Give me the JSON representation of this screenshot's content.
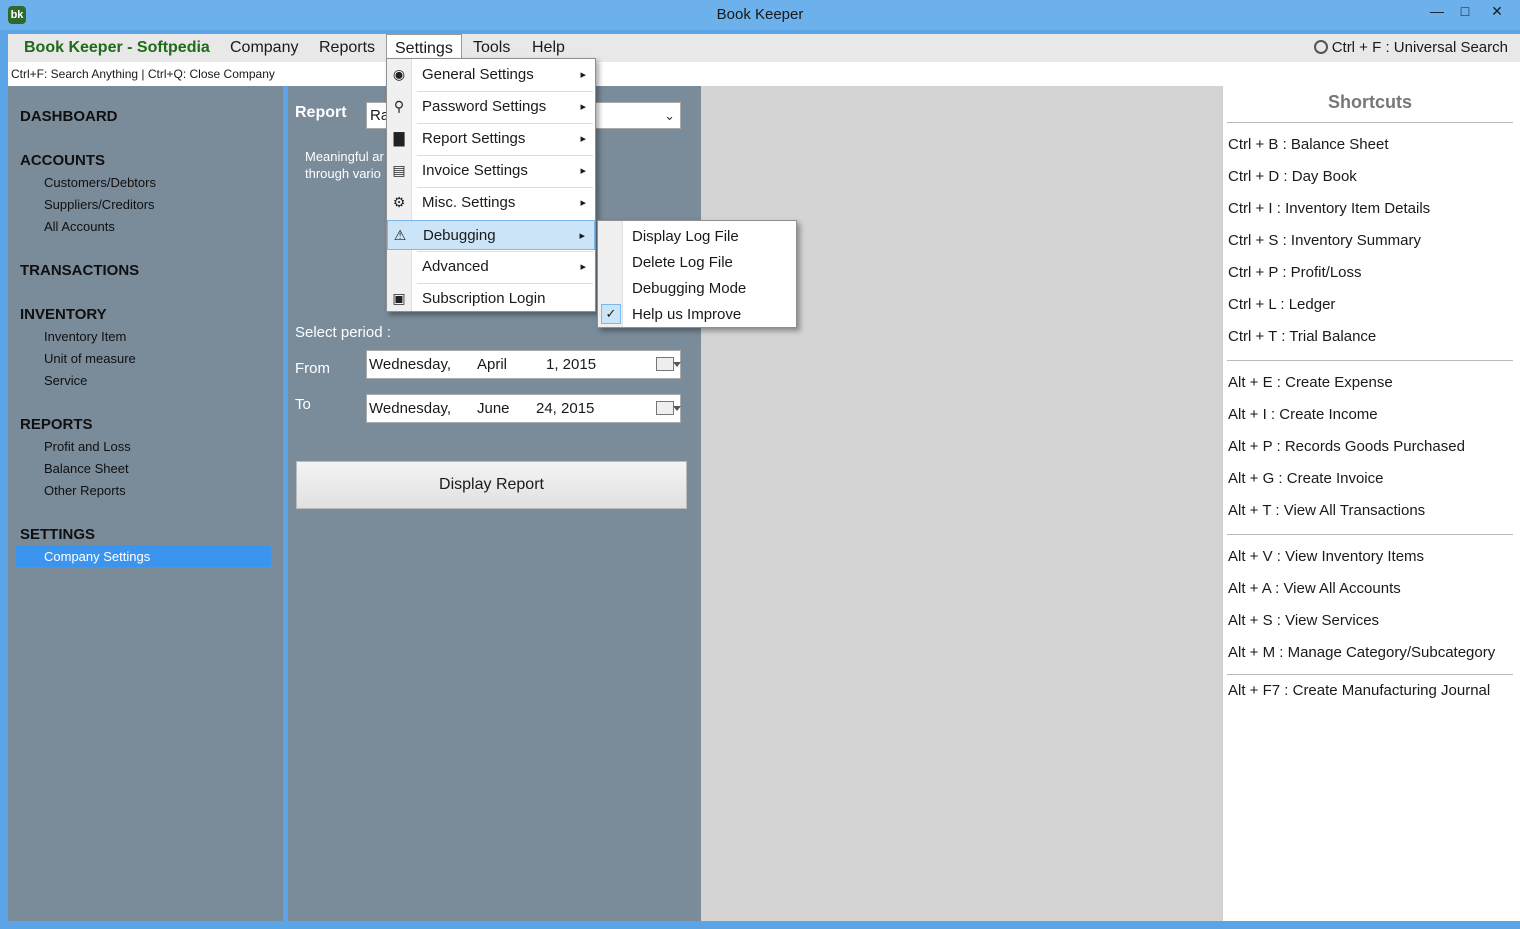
{
  "window": {
    "title": "Book Keeper",
    "app_icon": "bk"
  },
  "menubar": {
    "brand": "Book Keeper - Softpedia",
    "items": [
      "Company",
      "Reports",
      "Settings",
      "Tools",
      "Help"
    ],
    "universal_search": "Ctrl + F  : Universal Search"
  },
  "hint": "Ctrl+F: Search Anything | Ctrl+Q: Close Company",
  "sidebar": {
    "sections": [
      {
        "title": "DASHBOARD",
        "items": []
      },
      {
        "title": "ACCOUNTS",
        "items": [
          "Customers/Debtors",
          "Suppliers/Creditors",
          "All Accounts"
        ]
      },
      {
        "title": "TRANSACTIONS",
        "items": []
      },
      {
        "title": "INVENTORY",
        "items": [
          "Inventory Item",
          "Unit of measure",
          "Service"
        ]
      },
      {
        "title": "REPORTS",
        "items": [
          "Profit and Loss",
          "Balance Sheet",
          "Other Reports"
        ]
      },
      {
        "title": "SETTINGS",
        "items": [
          "Company Settings"
        ]
      }
    ],
    "selected": "Company Settings"
  },
  "report_panel": {
    "report_label": "Report",
    "report_value": "Ra",
    "description_line1": "Meaningful ar",
    "description_line2": "through vario",
    "select_period_label": "Select period :",
    "from_label": "From",
    "to_label": "To",
    "from_date": {
      "weekday": "Wednesday,",
      "month": "April",
      "day_year": "1, 2015"
    },
    "to_date": {
      "weekday": "Wednesday,",
      "month": "June",
      "day_year": "24, 2015"
    },
    "display_button": "Display Report"
  },
  "settings_menu": {
    "items": [
      {
        "label": "General Settings",
        "icon": "globe-icon",
        "submenu": true
      },
      {
        "label": "Password Settings",
        "icon": "key-icon",
        "submenu": true
      },
      {
        "label": "Report Settings",
        "icon": "bar-chart-icon",
        "submenu": true
      },
      {
        "label": "Invoice Settings",
        "icon": "invoice-icon",
        "submenu": true
      },
      {
        "label": "Misc. Settings",
        "icon": "gears-icon",
        "submenu": true
      },
      {
        "label": "Debugging",
        "icon": "warning-icon",
        "submenu": true
      },
      {
        "label": "Advanced",
        "icon": "",
        "submenu": true
      },
      {
        "label": "Subscription Login",
        "icon": "lock-icon",
        "submenu": false
      }
    ],
    "highlighted": "Debugging"
  },
  "debug_submenu": {
    "items": [
      "Display Log File",
      "Delete Log File",
      "Debugging Mode",
      "Help us Improve"
    ],
    "checked": "Help us Improve"
  },
  "shortcuts": {
    "title": "Shortcuts",
    "groups": [
      [
        "Ctrl + B : Balance Sheet",
        "Ctrl + D : Day Book",
        "Ctrl + I  : Inventory Item Details",
        "Ctrl + S : Inventory Summary",
        "Ctrl + P : Profit/Loss",
        "Ctrl + L : Ledger",
        "Ctrl + T : Trial Balance"
      ],
      [
        "Alt + E : Create Expense",
        "Alt + I  : Create Income",
        "Alt + P : Records Goods Purchased",
        "Alt + G : Create Invoice",
        "Alt + T : View All Transactions"
      ],
      [
        "Alt + V : View Inventory Items",
        "Alt + A : View All Accounts",
        "Alt + S : View Services",
        "Alt + M : Manage Category/Subcategory"
      ],
      [
        "Alt + F7 : Create Manufacturing Journal"
      ]
    ]
  },
  "colors": {
    "sidebar_bg": "#7a8b9a",
    "selected_bg": "#3b95ef",
    "brand": "#1f6b1a",
    "titlebar": "#6cb0ec"
  }
}
